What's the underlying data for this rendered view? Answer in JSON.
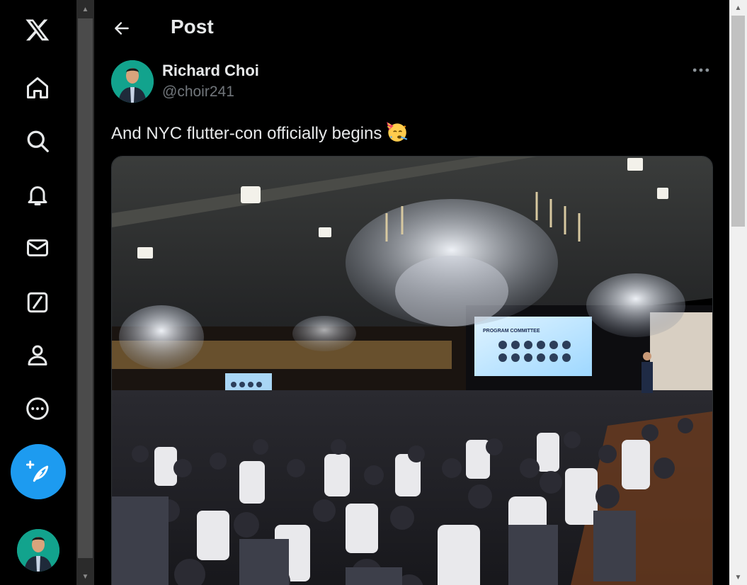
{
  "nav": {
    "logo": "x-logo-icon",
    "items": [
      {
        "icon": "home-icon"
      },
      {
        "icon": "search-icon"
      },
      {
        "icon": "bell-icon"
      },
      {
        "icon": "mail-icon"
      },
      {
        "icon": "grok-icon"
      },
      {
        "icon": "profile-icon"
      },
      {
        "icon": "more-circle-icon"
      }
    ],
    "compose_icon": "feather-plus-icon"
  },
  "header": {
    "title": "Post",
    "back_icon": "arrow-left-icon"
  },
  "post": {
    "author_name": "Richard Choi",
    "author_handle": "@choir241",
    "text": "And NYC flutter-con officially begins",
    "emoji": "partying-face-icon",
    "more_icon": "ellipsis-icon"
  },
  "media": {
    "screen_heading": "PROGRAM COMMITTEE"
  },
  "colors": {
    "accent": "#1d9bf0",
    "background": "#000000",
    "text_primary": "#e7e9ea",
    "text_secondary": "#71767b"
  }
}
